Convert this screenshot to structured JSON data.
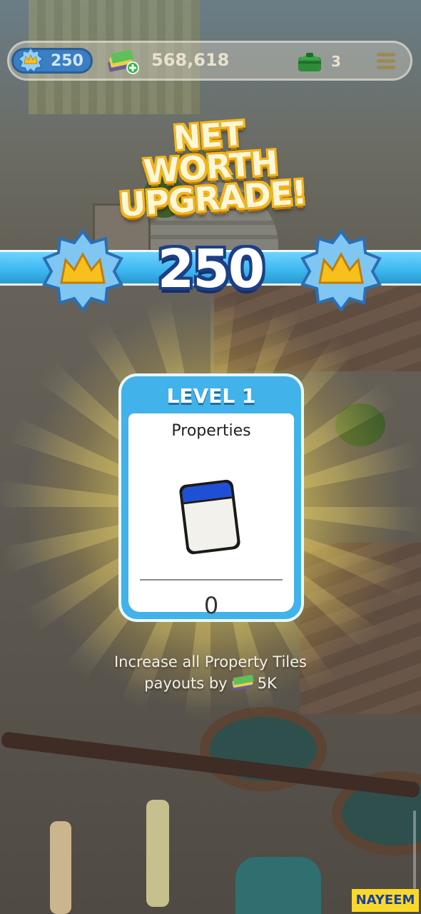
{
  "hud": {
    "stars_value": "250",
    "cash_value": "568,618",
    "chest_value": "3"
  },
  "title": {
    "line1": "NET WORTH",
    "line2": "UPGRADE!"
  },
  "ribbon": {
    "value": "250"
  },
  "card": {
    "level_label": "LEVEL 1",
    "name": "Properties",
    "count": "0",
    "accent_color": "#41b2ea",
    "tile_color": "#1f4fd6"
  },
  "description": {
    "line1": "Increase all Property Tiles",
    "line2_prefix": "payouts by",
    "line2_amount": "5K"
  },
  "icons": {
    "stars_badge": "net-worth-badge-icon",
    "cash": "cash-stack-icon",
    "chest": "green-chest-icon",
    "menu": "menu-icon"
  },
  "watermark": "NAYEEM"
}
